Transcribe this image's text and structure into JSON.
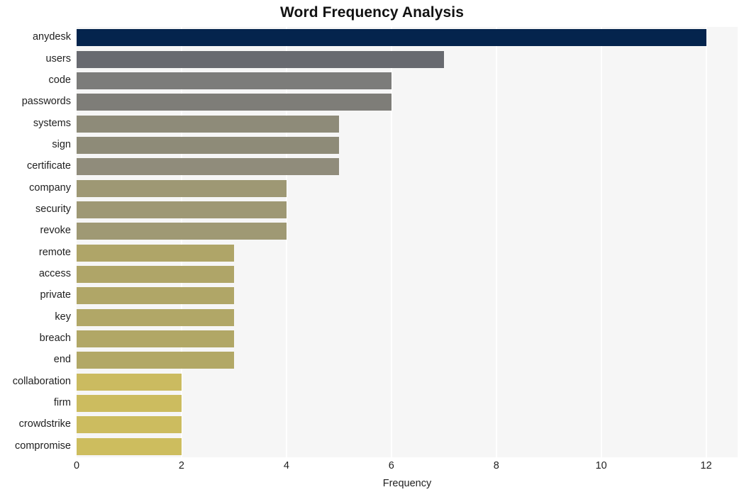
{
  "chart_data": {
    "type": "bar",
    "orientation": "horizontal",
    "title": "Word Frequency Analysis",
    "xlabel": "Frequency",
    "ylabel": "",
    "categories": [
      "anydesk",
      "users",
      "code",
      "passwords",
      "systems",
      "sign",
      "certificate",
      "company",
      "security",
      "revoke",
      "remote",
      "access",
      "private",
      "key",
      "breach",
      "end",
      "collaboration",
      "firm",
      "crowdstrike",
      "compromise"
    ],
    "values": [
      12,
      7,
      6,
      6,
      5,
      5,
      5,
      4,
      4,
      4,
      3,
      3,
      3,
      3,
      3,
      3,
      2,
      2,
      2,
      2
    ],
    "bar_colors": [
      "#04244d",
      "#686a70",
      "#7c7c7a",
      "#7e7d78",
      "#8e8b79",
      "#8e8b78",
      "#908c7b",
      "#9e9874",
      "#9e9874",
      "#9f9974",
      "#afa568",
      "#afa568",
      "#b0a667",
      "#b1a767",
      "#b1a766",
      "#b2a866",
      "#cbbb60",
      "#ccbc5f",
      "#ccbc5f",
      "#cdbd5e"
    ],
    "xlim": [
      0,
      12.6
    ],
    "xticks": [
      "0",
      "2",
      "4",
      "6",
      "8",
      "10",
      "12"
    ],
    "xtick_values": [
      0,
      2,
      4,
      6,
      8,
      10,
      12
    ],
    "grid": "vertical",
    "plot_background": "#f6f6f6",
    "gridline_color": "#ffffff",
    "figure_background": "#ffffff",
    "legend": null
  }
}
